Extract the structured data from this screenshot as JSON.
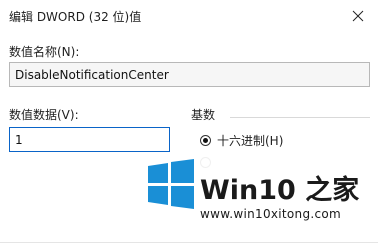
{
  "window": {
    "title": "编辑 DWORD (32 位)值",
    "close_icon": "close-icon"
  },
  "name_field": {
    "label": "数值名称(N):",
    "value": "DisableNotificationCenter"
  },
  "data_field": {
    "label": "数值数据(V):",
    "value": "1"
  },
  "base_group": {
    "label": "基数",
    "options": [
      {
        "label": "十六进制(H)",
        "selected": true
      }
    ]
  },
  "watermark": {
    "brand": "Win10 之家",
    "url": "www.win10xitong.com",
    "colors": {
      "logo_blue": "#1a8fd6"
    }
  }
}
